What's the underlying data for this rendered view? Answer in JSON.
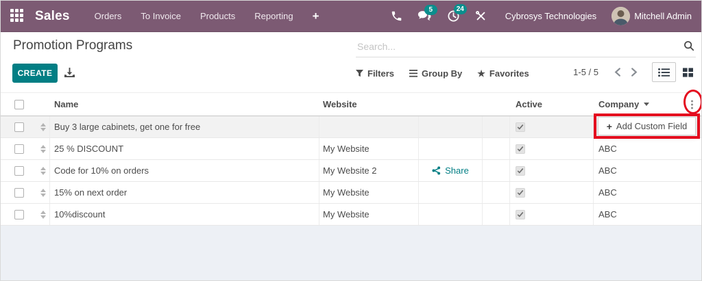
{
  "nav": {
    "app_name": "Sales",
    "items": [
      "Orders",
      "To Invoice",
      "Products",
      "Reporting"
    ],
    "message_badge": "5",
    "activity_badge": "24",
    "company_name": "Cybrosys Technologies",
    "user_name": "Mitchell Admin"
  },
  "control_panel": {
    "title": "Promotion Programs",
    "create_label": "CREATE",
    "search_placeholder": "Search...",
    "filters_label": "Filters",
    "group_by_label": "Group By",
    "favorites_label": "Favorites",
    "favorites_star": "★",
    "pager_text": "1-5 / 5"
  },
  "table": {
    "headers": {
      "name": "Name",
      "website": "Website",
      "active": "Active",
      "company": "Company"
    },
    "share_label": "Share",
    "rows": [
      {
        "name": "Buy 3 large cabinets, get one for free",
        "website": "",
        "share": false,
        "active": true,
        "company": ""
      },
      {
        "name": "25 % DISCOUNT",
        "website": "My Website",
        "share": false,
        "active": true,
        "company": "ABC"
      },
      {
        "name": "Code for 10% on orders",
        "website": "My Website 2",
        "share": true,
        "active": true,
        "company": "ABC"
      },
      {
        "name": "15% on next order",
        "website": "My Website",
        "share": false,
        "active": true,
        "company": "ABC"
      },
      {
        "name": "10%discount",
        "website": "My Website",
        "share": false,
        "active": true,
        "company": "ABC"
      }
    ]
  },
  "dropdown": {
    "plus": "+",
    "label": "Add Custom Field"
  },
  "colors": {
    "navbar_bg": "#7c5a73",
    "accent_teal": "#017e84",
    "badge_teal": "#0b8e8d",
    "annotation_red": "#e40b1e",
    "row_highlight": "#f2f2f2",
    "footer_bg": "#edf0f5"
  },
  "icons": {
    "apps-grid-icon": "3x3-white-squares",
    "phone-icon": "handset",
    "chat-icon": "speech-bubbles",
    "activity-clock-icon": "clock",
    "tools-icon": "crossed-wrench-screwdriver",
    "search-icon": "magnifier",
    "filter-icon": "funnel",
    "group-by-icon": "triple-bars",
    "favorites-icon": "star",
    "pager-prev-icon": "chevron-left",
    "pager-next-icon": "chevron-right",
    "list-view-icon": "bullet-list",
    "kanban-view-icon": "four-squares",
    "download-icon": "arrow-into-tray",
    "drag-handle-icon": "up-down-triangles",
    "sort-desc-icon": "caret-down",
    "column-options-icon": "vertical-ellipsis",
    "share-icon": "share-nodes",
    "checkmark-icon": "check"
  }
}
